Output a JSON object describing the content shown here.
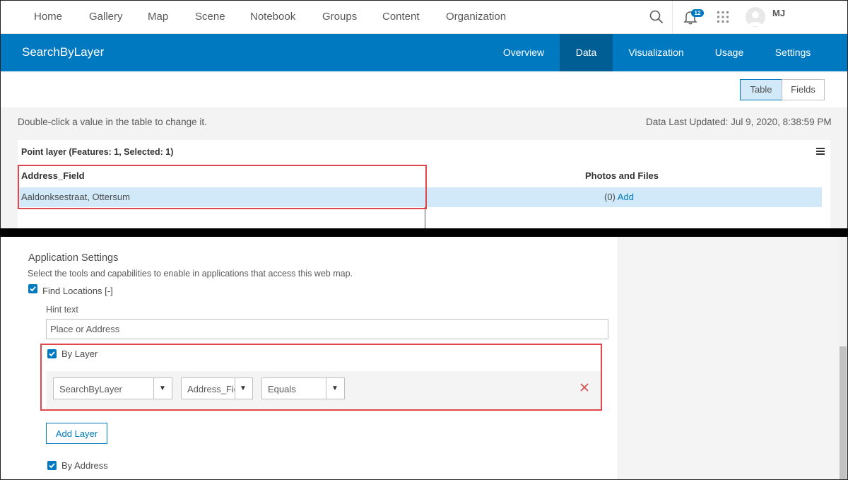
{
  "global_nav": {
    "links": [
      "Home",
      "Gallery",
      "Map",
      "Scene",
      "Notebook",
      "Groups",
      "Content",
      "Organization"
    ],
    "notification_count": "12",
    "user_initials": "MJ"
  },
  "item_header": {
    "title": "SearchByLayer",
    "tabs": [
      "Overview",
      "Data",
      "Visualization",
      "Usage",
      "Settings"
    ],
    "active_tab": "Data"
  },
  "view_toggle": {
    "table_label": "Table",
    "fields_label": "Fields"
  },
  "data_panel": {
    "hint": "Double-click a value in the table to change it.",
    "last_updated": "Data Last Updated: Jul 9, 2020, 8:38:59 PM",
    "layer_header": "Point layer (Features: 1, Selected: 1)",
    "columns": [
      "Address_Field",
      "Photos and Files"
    ],
    "rows": [
      {
        "address": "Aaldonksestraat, Ottersum",
        "photo_count": "(0)",
        "photo_link": "Add"
      }
    ]
  },
  "app_settings": {
    "title": "Application Settings",
    "description": "Select the tools and capabilities to enable in applications that access this web map.",
    "find_locations_label": "Find Locations [-]",
    "hint_text_label": "Hint text",
    "hint_text_value": "Place or Address",
    "by_layer_label": "By Layer",
    "layer_select": "SearchByLayer",
    "field_select": "Address_Field",
    "operator_select": "Equals",
    "add_layer_label": "Add Layer",
    "by_address_label": "By Address"
  },
  "colors": {
    "accent": "#0079c1",
    "highlight": "#e0474c",
    "selected_row": "#d2e9f9"
  },
  "icons": [
    "search-icon",
    "bell-icon",
    "apps-grid-icon",
    "avatar-icon",
    "hamburger-menu-icon",
    "checkbox-checked-icon",
    "dropdown-arrow-icon",
    "close-icon"
  ]
}
